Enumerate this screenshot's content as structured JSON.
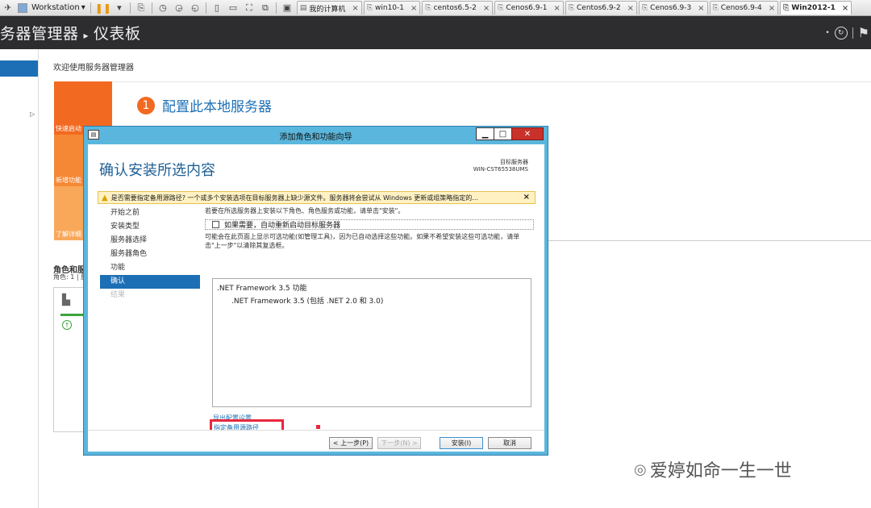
{
  "vmware": {
    "menu_label": "Workstation",
    "tabs": [
      {
        "label": "我的计算机",
        "icon": "computer-icon",
        "active": false
      },
      {
        "label": "win10-1",
        "icon": "vm-icon",
        "active": false
      },
      {
        "label": "centos6.5-2",
        "icon": "vm-icon",
        "active": false
      },
      {
        "label": "Cenos6.9-1",
        "icon": "vm-icon",
        "active": false
      },
      {
        "label": "Centos6.9-2",
        "icon": "vm-icon",
        "active": false
      },
      {
        "label": "Cenos6.9-3",
        "icon": "vm-icon",
        "active": false
      },
      {
        "label": "Cenos6.9-4",
        "icon": "vm-icon",
        "active": false
      },
      {
        "label": "Win2012-1",
        "icon": "vm-icon",
        "active": true
      }
    ]
  },
  "server_manager": {
    "title": "务器管理器",
    "crumb_separator": "▸",
    "page": "仪表板",
    "welcome": "欢迎使用服务器管理器",
    "step1_number": "1",
    "step1_text": "配置此本地服务器",
    "tiles": [
      "快速启动",
      "新增功能",
      "了解详细"
    ],
    "roles_heading": "角色和服务",
    "roles_sub": "角色: 1 | 服"
  },
  "wizard": {
    "title": "添加角色和功能向导",
    "heading": "确认安装所选内容",
    "dest_label": "目标服务器",
    "dest_server": "WIN-CST65538UMS",
    "warning": "是否需要指定备用源路径? 一个或多个安装选项在目标服务器上缺少源文件。服务器将会尝试从 Windows 更新或组策略指定的...",
    "steps": [
      {
        "label": "开始之前",
        "state": "normal"
      },
      {
        "label": "安装类型",
        "state": "normal"
      },
      {
        "label": "服务器选择",
        "state": "normal"
      },
      {
        "label": "服务器角色",
        "state": "normal"
      },
      {
        "label": "功能",
        "state": "normal"
      },
      {
        "label": "确认",
        "state": "selected"
      },
      {
        "label": "结果",
        "state": "disabled"
      }
    ],
    "intro": "若要在所选服务器上安装以下角色、角色服务或功能，请单击\"安装\"。",
    "restart_label": "如果需要，自动重新启动目标服务器",
    "note": "可能会在此页面上显示可选功能(如管理工具)，因为已自动选择这些功能。如果不希望安装这些可选功能，请单击\"上一步\"以清除其复选框。",
    "features": [
      ".NET Framework 3.5 功能",
      ".NET Framework 3.5 (包括 .NET 2.0 和 3.0)"
    ],
    "export_link": "导出配置设置",
    "alt_source_link": "指定备用源路径",
    "buttons": {
      "prev": "< 上一步(P)",
      "next": "下一步(N) >",
      "install": "安装(I)",
      "cancel": "取消"
    }
  },
  "watermark": "爱婷如命一生一世",
  "colors": {
    "accent": "#1c6fb5",
    "orange": "#f26a21",
    "highlight": "#e8283d",
    "dialog_frame": "#5ab6dc"
  }
}
